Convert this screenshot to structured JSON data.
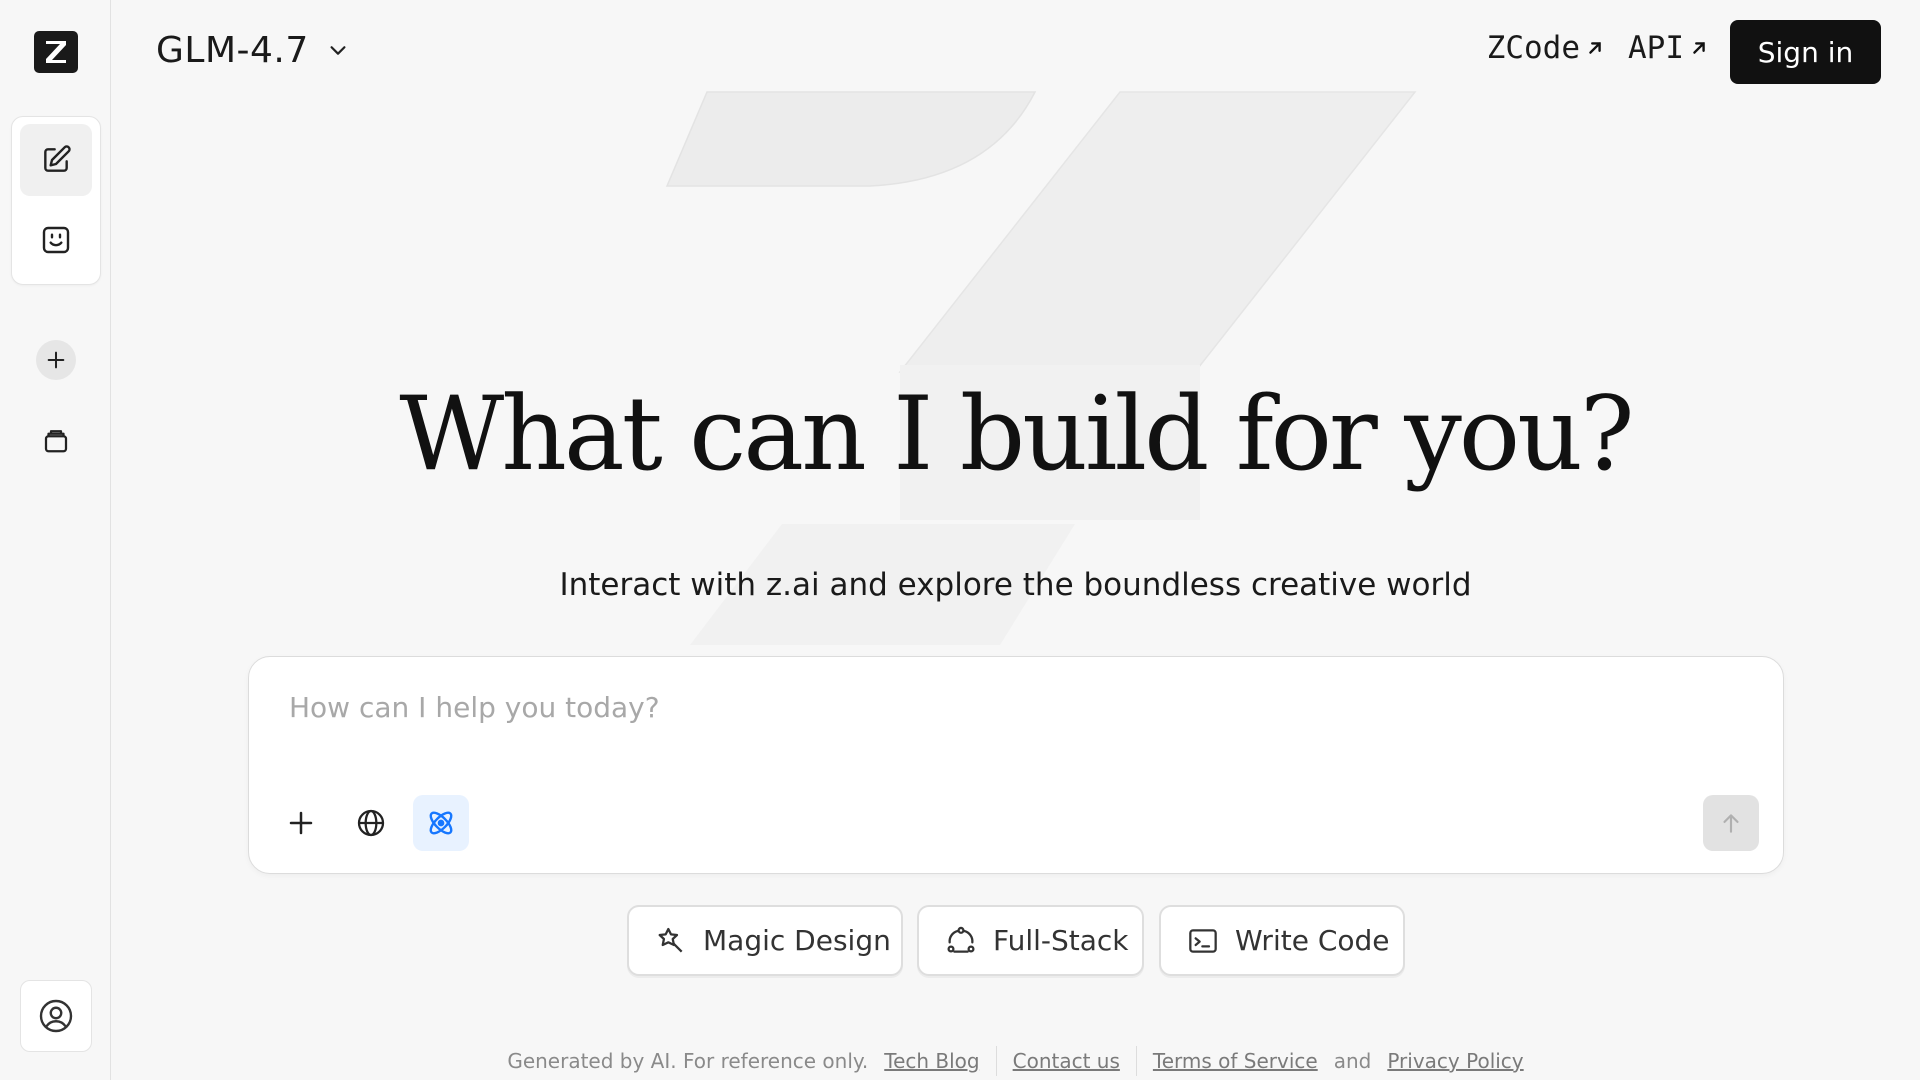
{
  "header": {
    "model_name": "GLM-4.7",
    "links": [
      {
        "label": "ZCode"
      },
      {
        "label": "API"
      }
    ],
    "signin_label": "Sign in"
  },
  "sidebar": {
    "logo_icon": "z-logo-icon",
    "tools": [
      "new-chat-icon",
      "agent-face-icon"
    ],
    "actions": [
      "plus-icon",
      "library-icon"
    ],
    "user_icon": "user-icon"
  },
  "hero": {
    "title": "What can I build for you?",
    "subtitle": "Interact with z.ai and explore the boundless creative world"
  },
  "input": {
    "placeholder": "How can I help you today?",
    "value": "",
    "active_tool_color": "#1677ff"
  },
  "chips": [
    {
      "label": "Magic Design",
      "icon": "magic-design-icon"
    },
    {
      "label": "Full-Stack",
      "icon": "full-stack-icon"
    },
    {
      "label": "Write Code",
      "icon": "terminal-icon"
    }
  ],
  "footer": {
    "disclaimer": "Generated by AI. For reference only.",
    "tech_blog": "Tech Blog",
    "contact": "Contact us",
    "terms": "Terms of Service",
    "and": "and",
    "privacy": "Privacy Policy"
  }
}
